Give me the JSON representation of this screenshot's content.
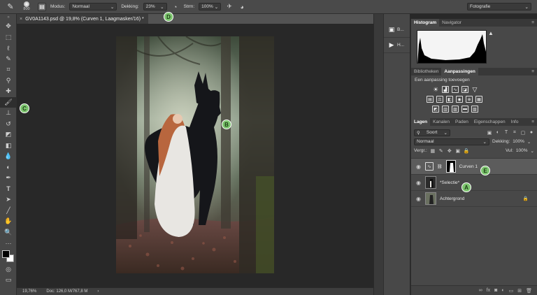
{
  "options_bar": {
    "brush_size": "800",
    "mode_label": "Modus:",
    "mode_value": "Normaal",
    "opacity_label": "Dekking:",
    "opacity_value": "23%",
    "flow_label": "Strm:",
    "flow_value": "100%",
    "workspace": "Fotografie"
  },
  "document": {
    "tab_title": "GV0A1143.psd @ 19,8% (Curven 1, Laagmasker/16) *",
    "zoom": "19,76%",
    "doc_info": "Doc: 126,0 M/767,8 M"
  },
  "markers": {
    "A": "A",
    "B": "B",
    "C": "C",
    "D": "D",
    "E": "E"
  },
  "dock_items": [
    {
      "icon": "brush-preset-icon",
      "label": "B..."
    },
    {
      "icon": "play-icon",
      "label": "H..."
    }
  ],
  "histogram_panel": {
    "tabs": [
      "Histogram",
      "Navigator"
    ]
  },
  "adjustments_panel": {
    "tabs": [
      "Bibliotheken",
      "Aanpassingen"
    ],
    "title": "Een aanpassing toevoegen"
  },
  "layers_panel": {
    "tabs": [
      "Lagen",
      "Kanalen",
      "Paden",
      "Eigenschappen",
      "Info"
    ],
    "filter_kind": "Soort",
    "blend_mode": "Normaal",
    "opacity_label": "Dekking:",
    "opacity_value": "100%",
    "lock_label": "Vergr.:",
    "fill_label": "Vul:",
    "fill_value": "100%",
    "layers": [
      {
        "name": "Curven 1",
        "selected": true
      },
      {
        "name": "*Selectie*",
        "selected": false
      },
      {
        "name": "Achtergrond",
        "selected": false
      }
    ]
  },
  "colors": {
    "marker": "#7cc46e",
    "selected_layer": "#5c5c5c",
    "panel": "#484848"
  }
}
